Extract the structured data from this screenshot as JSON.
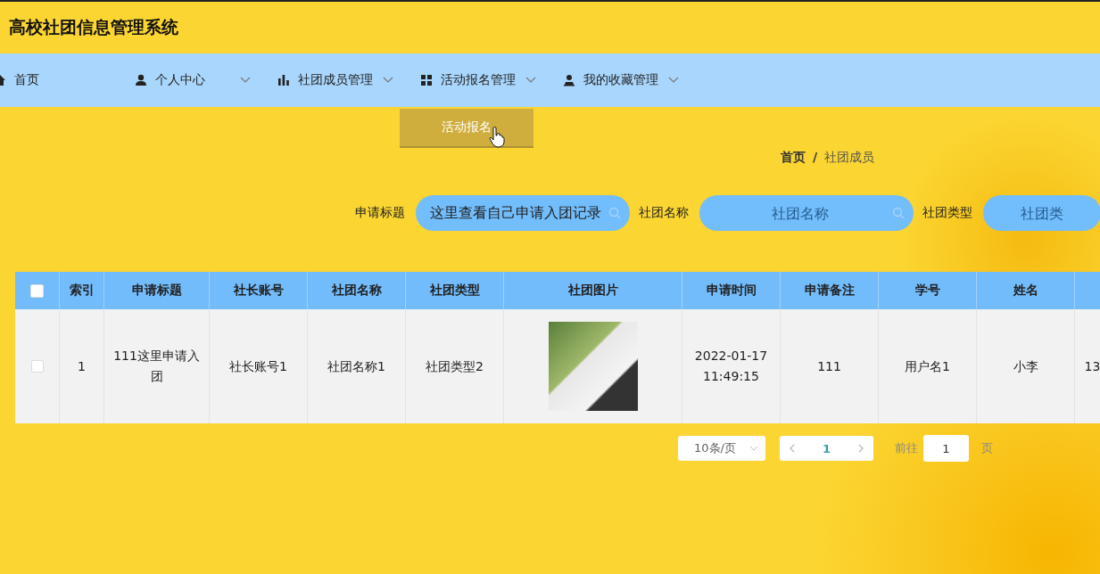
{
  "title": "高校社团信息管理系统",
  "nav": [
    {
      "label": "首页",
      "kind": "home",
      "dropdown": false
    },
    {
      "label": "个人中心",
      "kind": "user",
      "dropdown": true
    },
    {
      "label": "社团成员管理",
      "kind": "bars",
      "dropdown": true
    },
    {
      "label": "活动报名管理",
      "kind": "grid",
      "dropdown": true
    },
    {
      "label": "我的收藏管理",
      "kind": "person",
      "dropdown": true
    }
  ],
  "dropdown_menu": {
    "items": [
      "活动报名"
    ]
  },
  "breadcrumb": {
    "items": [
      "首页",
      "社团成员"
    ],
    "separator": "/"
  },
  "search": [
    {
      "label": "申请标题",
      "value": "这里查看自己申请入团记录"
    },
    {
      "label": "社团名称",
      "placeholder": "社团名称"
    },
    {
      "label": "社团类型",
      "placeholder": "社团类"
    }
  ],
  "table": {
    "select_all_checked": false,
    "columns": [
      "索引",
      "申请标题",
      "社长账号",
      "社团名称",
      "社团类型",
      "社团图片",
      "申请时间",
      "申请备注",
      "学号",
      "姓名"
    ],
    "rows": [
      {
        "checked": false,
        "cells": [
          {
            "kind": "text",
            "text": "1"
          },
          {
            "kind": "text",
            "text": "111这里申请入团"
          },
          {
            "kind": "text",
            "text": "社长账号1"
          },
          {
            "kind": "text",
            "text": "社团名称1"
          },
          {
            "kind": "text",
            "text": "社团类型2"
          },
          {
            "kind": "image"
          },
          {
            "kind": "text",
            "text": "2022-01-17 11:49:15"
          },
          {
            "kind": "text",
            "text": "111"
          },
          {
            "kind": "text",
            "text": "用户名1"
          },
          {
            "kind": "text",
            "text": "小李"
          },
          {
            "kind": "text",
            "text": "13"
          }
        ]
      }
    ]
  },
  "pagination": {
    "page_size": "10条/页",
    "pages": [
      {
        "label": "1",
        "selected": true
      }
    ],
    "goto_label": "前往",
    "goto_value": "1",
    "goto_suffix": "页"
  }
}
